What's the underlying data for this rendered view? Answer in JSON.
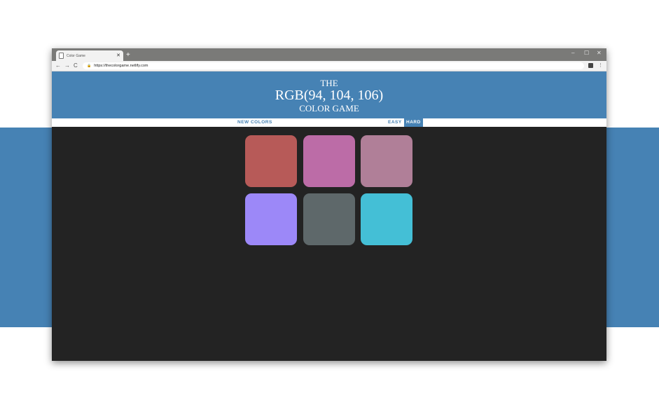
{
  "browser": {
    "tab_title": "Color Game",
    "new_tab": "+",
    "url": "https://thecolorgame.netlify.com",
    "controls": {
      "minimize": "–",
      "maximize": "☐",
      "close": "✕"
    },
    "nav": {
      "back": "←",
      "forward": "→",
      "reload": "C"
    }
  },
  "header": {
    "line1": "THE",
    "rgb": "RGB(94, 104, 106)",
    "line3": "COLOR GAME",
    "color": "#4682b4"
  },
  "stripe": {
    "new_colors": "NEW COLORS",
    "easy": "EASY",
    "hard": "HARD",
    "selected_mode": "hard"
  },
  "squares": [
    {
      "color": "#b75a58"
    },
    {
      "color": "#bc6ca7"
    },
    {
      "color": "#b07f98"
    },
    {
      "color": "#9c88f8"
    },
    {
      "color": "#5e686a"
    },
    {
      "color": "#44bfd6"
    }
  ],
  "colors": {
    "background": "#232323",
    "accent": "#4682b4"
  }
}
